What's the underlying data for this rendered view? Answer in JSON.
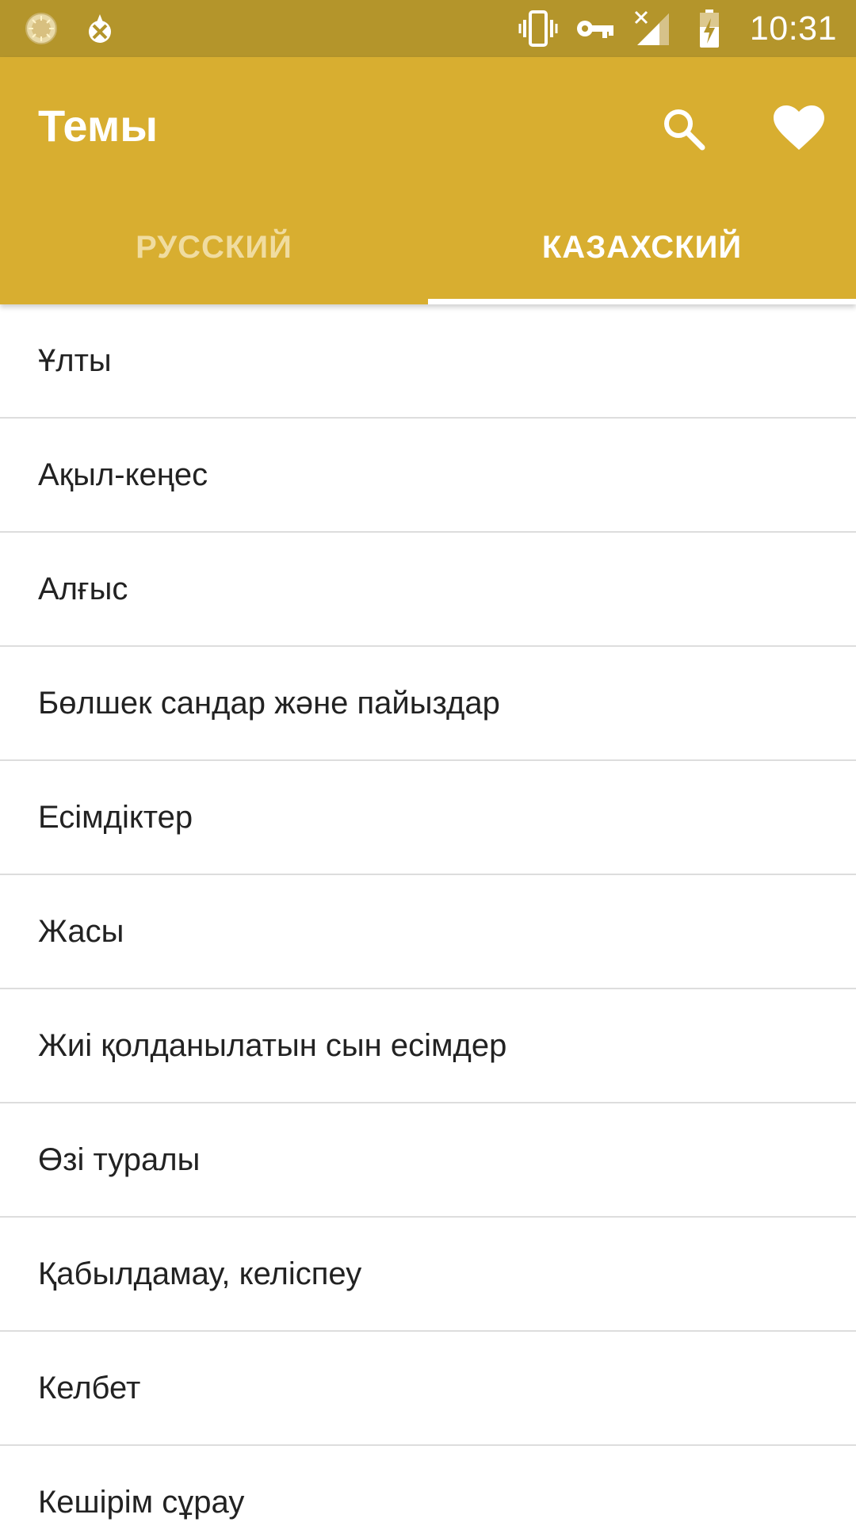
{
  "status_bar": {
    "time": "10:31",
    "left_icons": [
      "sun-notification-icon",
      "app-notification-icon"
    ],
    "right_icons": [
      "vibrate-icon",
      "vpn-key-icon",
      "signal-no-service-icon",
      "battery-charging-icon"
    ]
  },
  "app_bar": {
    "title": "Темы",
    "actions": [
      "search-icon",
      "favorite-heart-icon"
    ],
    "colors": {
      "status_bar": "#b4952b",
      "toolbar": "#d8ae30",
      "tab_inactive_text": "#f0dca0",
      "tab_active_text": "#ffffff"
    }
  },
  "tabs": [
    {
      "label": "РУССКИЙ",
      "selected": false
    },
    {
      "label": "КАЗАХСКИЙ",
      "selected": true
    }
  ],
  "topics": [
    "Ұлты",
    "Ақыл-кеңес",
    "Алғыс",
    "Бөлшек сандар және пайыздар",
    "Есімдіктер",
    "Жасы",
    "Жиі қолданылатын сын есімдер",
    "Өзі туралы",
    "Қабылдамау, келіспеу",
    "Келбет",
    "Кешірім сұрау"
  ]
}
